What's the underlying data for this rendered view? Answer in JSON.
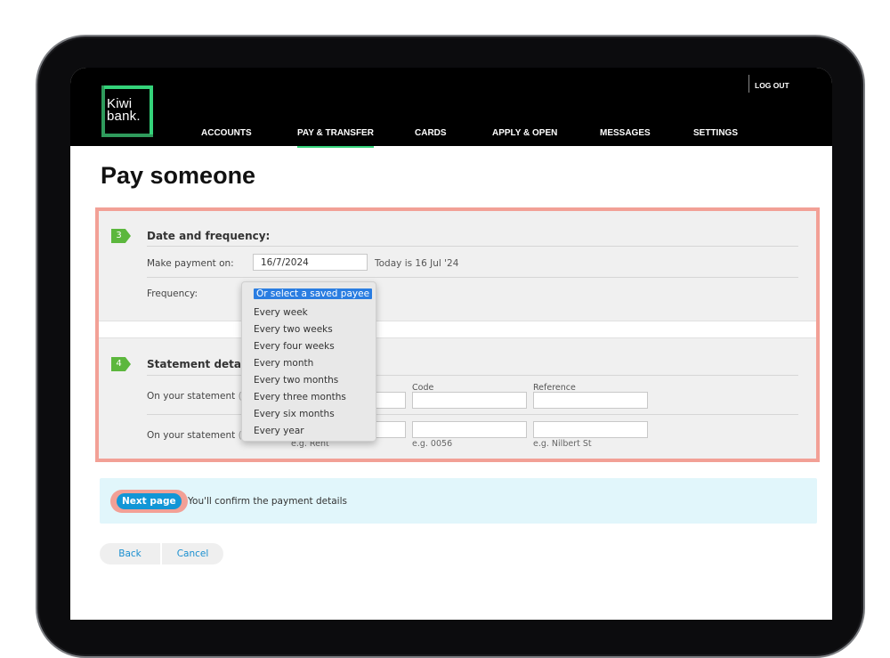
{
  "header": {
    "logo_line1": "Kiwi",
    "logo_line2": "bank.",
    "logout": "LOG OUT",
    "nav": [
      {
        "label": "ACCOUNTS",
        "active": false
      },
      {
        "label": "PAY & TRANSFER",
        "active": true
      },
      {
        "label": "CARDS",
        "active": false
      },
      {
        "label": "APPLY & OPEN",
        "active": false
      },
      {
        "label": "MESSAGES",
        "active": false
      },
      {
        "label": "SETTINGS",
        "active": false
      }
    ]
  },
  "page_title": "Pay someone",
  "section3": {
    "step": "3",
    "title": "Date and frequency:",
    "make_payment_label": "Make payment on:",
    "date_value": "16/7/2024",
    "today_text": "Today is 16 Jul '24",
    "frequency_label": "Frequency:"
  },
  "frequency_dropdown": {
    "options": [
      "Or select a saved payee",
      "Every week",
      "Every two weeks",
      "Every four weeks",
      "Every month",
      "Every two months",
      "Every three months",
      "Every six months",
      "Every year"
    ],
    "selected_index": 0
  },
  "section4": {
    "step": "4",
    "title": "Statement details",
    "row1_label": "On your statement",
    "row1_label_muted": "(o",
    "row2_label": "On your statement",
    "row2_label_muted": "(o",
    "col_code": "Code",
    "col_reference": "Reference",
    "hint_particulars": "e.g. Rent",
    "hint_code": "e.g. 0056",
    "hint_reference": "e.g. Nilbert St"
  },
  "info_bar": {
    "next_button": "Next page",
    "text": "You'll confirm the payment details"
  },
  "footer_buttons": {
    "back": "Back",
    "cancel": "Cancel"
  },
  "colors": {
    "brand_green": "#34d37a",
    "highlight": "#f2a096",
    "primary_blue": "#1296d6",
    "step_green": "#5cb73d"
  }
}
